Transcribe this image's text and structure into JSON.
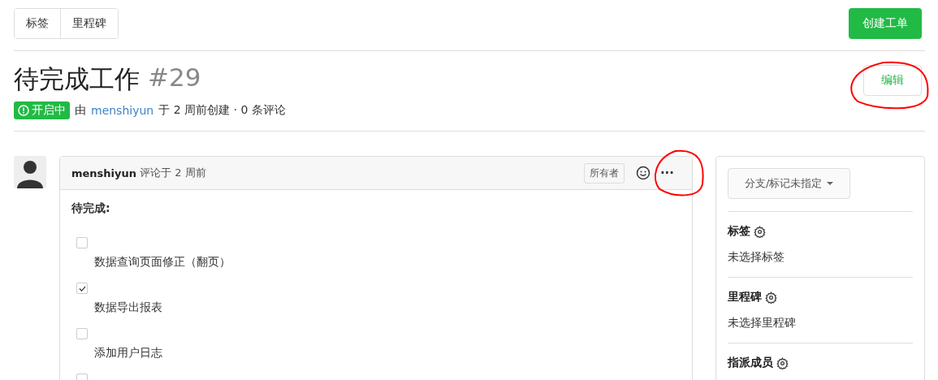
{
  "top_tabs": [
    {
      "label": "标签"
    },
    {
      "label": "里程碑"
    }
  ],
  "create_button": {
    "label": "创建工单"
  },
  "issue": {
    "title": "待完成工作",
    "number": "#29",
    "status": "开启中",
    "meta_prefix": "由",
    "author": "menshiyun",
    "meta_suffix": "于 2 周前创建 · 0 条评论"
  },
  "edit_button": {
    "label": "编辑",
    "circled": true
  },
  "comment": {
    "author": "menshiyun",
    "time": "评论于 2 周前",
    "role": "所有者",
    "more": "···",
    "more_circled": true,
    "heading": "待完成:",
    "tasks": [
      {
        "label": "数据查询页面修正（翻页）",
        "checked": false
      },
      {
        "label": "数据导出报表",
        "checked": true
      },
      {
        "label": "添加用户日志",
        "checked": false
      },
      {
        "checked": false
      }
    ]
  },
  "sidebar": {
    "branch_button": "分支/标记未指定",
    "sections": [
      {
        "title": "标签",
        "value": "未选择标签"
      },
      {
        "title": "里程碑",
        "value": "未选择里程碑"
      },
      {
        "title": "指派成员"
      }
    ]
  }
}
